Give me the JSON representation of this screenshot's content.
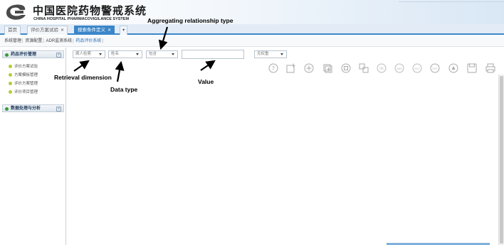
{
  "header": {
    "brand_cn": "中国医院药物警戒系统",
    "brand_en": "CHINA HOSPITAL PHARMACOVIGILANCE SYSTEM",
    "logo_color": "#4a4a4a"
  },
  "tabs": [
    {
      "label": "首页",
      "closable": false,
      "active": false
    },
    {
      "label": "评价方案试验",
      "closable": true,
      "active": false
    },
    {
      "label": "搜索条件定义",
      "closable": true,
      "active": true
    },
    {
      "label": "▾",
      "closable": false,
      "active": false
    }
  ],
  "breadcrumb": {
    "items": [
      "系统管理",
      "资源配置",
      "ADR监测系统",
      "药品评价系统"
    ]
  },
  "sidebar": {
    "panel1_title": "药品评价管理",
    "panel1_items": [
      "评价方案试验",
      "方案模板管理",
      "评价方案管理",
      "评价项目管理"
    ],
    "panel2_title": "数据处理与分析",
    "collapse_glyph": "«"
  },
  "toolbar": {
    "retrieval_dimension": "病人检索",
    "data_type": "姓名",
    "aggregating_relationship": "包含",
    "value": "",
    "extra_select": "无权重",
    "icons": [
      "help-icon",
      "add-child-icon",
      "add-icon",
      "copy-icon",
      "delete-icon",
      "move-icon",
      "and-icon",
      "or-icon",
      "not-icon",
      "group-icon",
      "clear-icon",
      "save-icon",
      "print-icon"
    ],
    "icon_labels": [
      "?",
      "",
      "+",
      "",
      "",
      "",
      "OR",
      "AND",
      "NOT",
      "(+)",
      "",
      "",
      ""
    ]
  },
  "annotations": {
    "aggregating": "Aggregating relationship type",
    "retrieval": "Retrieval dimension",
    "data_type": "Data type",
    "value": "Value"
  },
  "colors": {
    "accent": "#3a86c9",
    "bullet": "#b6cc3a",
    "panel_dot": "#3d9a3d"
  }
}
